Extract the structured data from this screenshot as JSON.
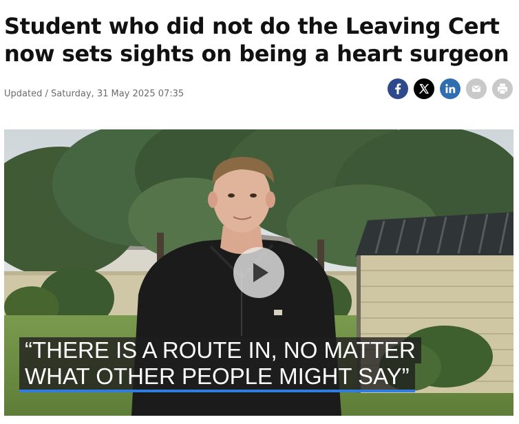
{
  "article": {
    "headline": "Student who did not do the Leaving Cert now sets sights on being a heart surgeon",
    "updated": "Updated / Saturday, 31 May 2025 07:35"
  },
  "share": [
    {
      "name": "facebook",
      "icon": "facebook-icon",
      "color": "#2f4a8c"
    },
    {
      "name": "x",
      "icon": "x-icon",
      "color": "#000000"
    },
    {
      "name": "linkedin",
      "icon": "linkedin-icon",
      "color": "#2f6fb0"
    },
    {
      "name": "email",
      "icon": "email-icon",
      "color": "#c9c9c9"
    },
    {
      "name": "print",
      "icon": "print-icon",
      "color": "#c9c9c9"
    }
  ],
  "video": {
    "caption_line1": "“THERE IS A ROUTE IN, NO MATTER",
    "caption_line2": "WHAT OTHER PEOPLE MIGHT SAY”",
    "caption_accent": "#2f7de0",
    "play_icon": "play-icon"
  }
}
